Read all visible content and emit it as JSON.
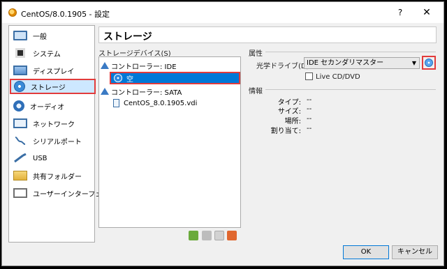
{
  "window": {
    "title": "CentOS/8.0.1905 - 設定",
    "help_label": "?",
    "close_label": "✕"
  },
  "sidebar": {
    "items": [
      {
        "label": "一般",
        "icon": "general-monitor-icon"
      },
      {
        "label": "システム",
        "icon": "system-chip-icon"
      },
      {
        "label": "ディスプレイ",
        "icon": "display-monitor-icon"
      },
      {
        "label": "ストレージ",
        "icon": "storage-disk-icon",
        "selected": true
      },
      {
        "label": "オーディオ",
        "icon": "audio-icon"
      },
      {
        "label": "ネットワーク",
        "icon": "network-icon"
      },
      {
        "label": "シリアルポート",
        "icon": "serial-port-icon"
      },
      {
        "label": "USB",
        "icon": "usb-icon"
      },
      {
        "label": "共有フォルダー",
        "icon": "shared-folder-icon"
      },
      {
        "label": "ユーザーインターフェース",
        "icon": "user-interface-icon"
      }
    ]
  },
  "page": {
    "title": "ストレージ"
  },
  "storage": {
    "devices_label": "ストレージデバイス(S)",
    "tree": {
      "controller_ide": "コントローラー: IDE",
      "ide_empty": "空",
      "controller_sata": "コントローラー: SATA",
      "sata_disk": "CentOS_8.0.1905.vdi"
    }
  },
  "attributes": {
    "section_label": "属性",
    "optical_drive_label": "光学ドライブ(D):",
    "optical_drive_value": "IDE セカンダリマスター",
    "live_cd_label": "Live CD/DVD",
    "live_cd_checked": false
  },
  "info": {
    "section_label": "情報",
    "rows": [
      {
        "key": "タイプ:",
        "value": "--"
      },
      {
        "key": "サイズ:",
        "value": "--"
      },
      {
        "key": "場所:",
        "value": "--"
      },
      {
        "key": "割り当て:",
        "value": "--"
      }
    ]
  },
  "buttons": {
    "ok": "OK",
    "cancel": "キャンセル"
  },
  "colors": {
    "selection": "#0078d7",
    "highlight_box": "#e23b3b",
    "sidebar_selected": "#cde8ff"
  }
}
